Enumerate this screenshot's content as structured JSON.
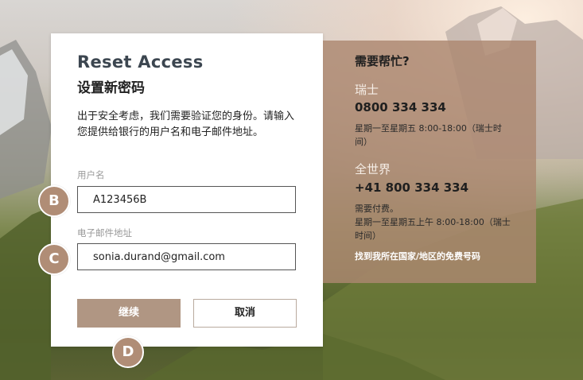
{
  "form": {
    "title": "Reset Access",
    "subtitle": "设置新密码",
    "description": "出于安全考虑，我们需要验证您的身份。请输入您提供给银行的用户名和电子邮件地址。",
    "username_label": "用户名",
    "username_value": "A123456B",
    "email_label": "电子邮件地址",
    "email_value": "sonia.durand@gmail.com",
    "continue_label": "继续",
    "cancel_label": "取消"
  },
  "badges": {
    "b": "B",
    "c": "C",
    "d": "D"
  },
  "help": {
    "title": "需要帮忙?",
    "switzerland_label": "瑞士",
    "switzerland_phone": "0800 334 334",
    "switzerland_hours": "星期一至星期五 8:00-18:00（瑞士时间）",
    "world_label": "全世界",
    "world_phone": "+41 800 334 334",
    "world_note": "需要付费。",
    "world_hours": "星期一至星期五上午 8:00-18:00（瑞士时间）",
    "free_numbers_link": "找到我所在国家/地区的免费号码"
  },
  "colors": {
    "accent": "#b09683",
    "badge": "#b08d76",
    "help_panel": "#ac8870"
  }
}
